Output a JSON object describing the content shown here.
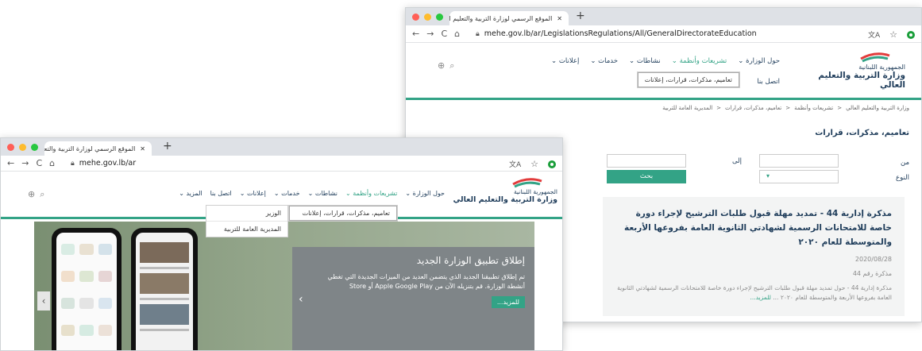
{
  "browser": {
    "tab_title": "الموقع الرسمي لوزارة التربية والتعليم العا..."
  },
  "back_window": {
    "url": "mehe.gov.lb/ar/LegislationsRegulations/All/GeneralDirectorateEducation",
    "logo_line1": "الجمهورية اللبنانية",
    "logo_line2": "وزارة التربية والتعليم العالي",
    "nav": [
      "حول الوزارة",
      "تشريعات وأنظمة",
      "نشاطات",
      "خدمات",
      "إعلانات"
    ],
    "contact_label": "اتصل بنا",
    "submenu_item": "تعاميم، مذكرات، قرارات، إعلانات",
    "breadcrumb": [
      "وزارة التربية والتعليم العالي",
      "تشريعات وأنظمة",
      "تعاميم، مذكرات، قرارات",
      "المديرية العامة للتربية"
    ],
    "page_title": "تعاميم، مذكرات، قرارات",
    "filter_from_label": "من",
    "filter_to_label": "إلى",
    "filter_type_label": "النوع",
    "search_button": "بحث",
    "article": {
      "title": "مذكرة إدارية 44 - تمديد مهلة قبول طلبات الترشيح لإجراء دورة خاصة للامتحانات الرسمية لشهادتي الثانوية العامة بفروعها الأربعة والمتوسطة للعام ٢٠٢٠",
      "date": "2020/08/28",
      "number": "مذكرة رقم 44",
      "excerpt": "مذكرة إدارية 44 - حول تمديد مهلة قبول طلبات الترشيح لإجراء دورة خاصة للامتحانات الرسمية لشهادتي الثانوية العامة بفروعها الأربعة والمتوسطة للعام ٢٠٢٠ ...",
      "more": "للمزيد..."
    }
  },
  "front_window": {
    "url": "mehe.gov.lb/ar",
    "logo_line1": "الجمهورية اللبنانية",
    "logo_line2": "وزارة التربية والتعليم العالي",
    "nav": [
      "حول الوزارة",
      "تشريعات وأنظمة",
      "نشاطات",
      "خدمات",
      "إعلانات",
      "اتصل بنا",
      "المزيد"
    ],
    "dropdown_main": "تعاميم، مذكرات، قرارات، إعلانات",
    "dropdown_sub": [
      "الوزير",
      "المديرية العامة للتربية"
    ],
    "banner": {
      "title": "إطلاق تطبيق الوزارة الجديد",
      "body": "تم إطلاق تطبيقنا الجديد الذي يتضمن العديد من الميزات الجديدة التي تغطي أنشطة الوزارة. قم بتنزيله الآن من Apple Google Play أو Store",
      "more": "للمزيد..."
    }
  },
  "colors": {
    "brand_green": "#33a386",
    "navy": "#1e3c5a",
    "banner_gray": "#7f8588"
  }
}
